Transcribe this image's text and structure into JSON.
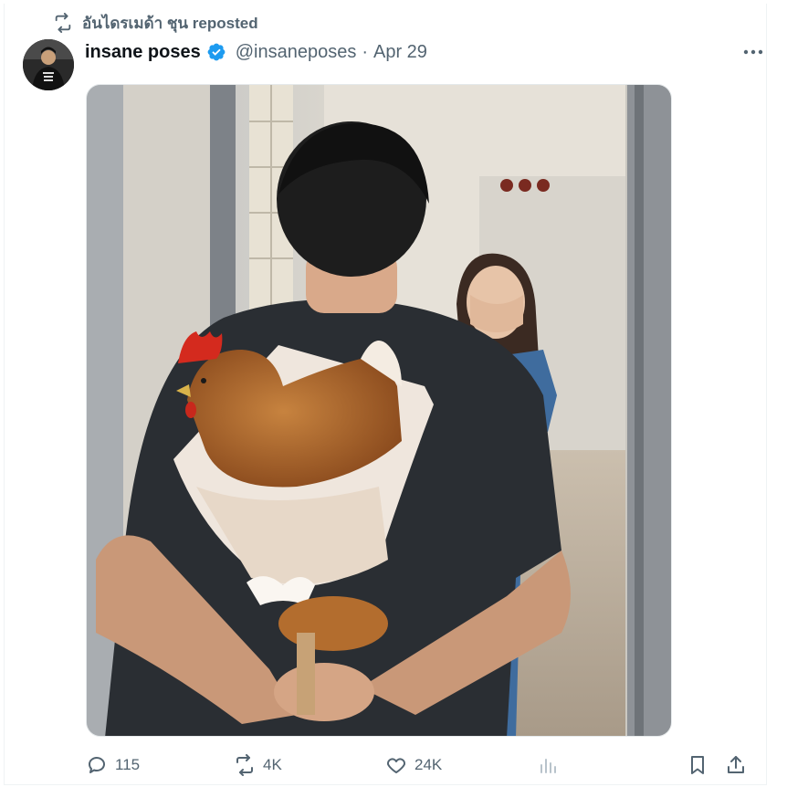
{
  "repost": {
    "user": "อันไดรเมด้า ชุน",
    "label": "reposted"
  },
  "tweet": {
    "display_name": "insane poses",
    "verified": true,
    "handle": "@insaneposes",
    "separator": "·",
    "date": "Apr 29"
  },
  "metrics": {
    "replies": "115",
    "reposts": "4K",
    "likes": "24K"
  },
  "icons": {
    "repost": "repost-icon",
    "verified": "verified-badge-icon",
    "more": "more-icon",
    "reply": "reply-icon",
    "like": "heart-icon",
    "views": "views-icon",
    "bookmark": "bookmark-icon",
    "share": "share-icon"
  },
  "colors": {
    "text_primary": "#0f1419",
    "text_secondary": "#536471",
    "verified_blue": "#1d9bf0"
  }
}
